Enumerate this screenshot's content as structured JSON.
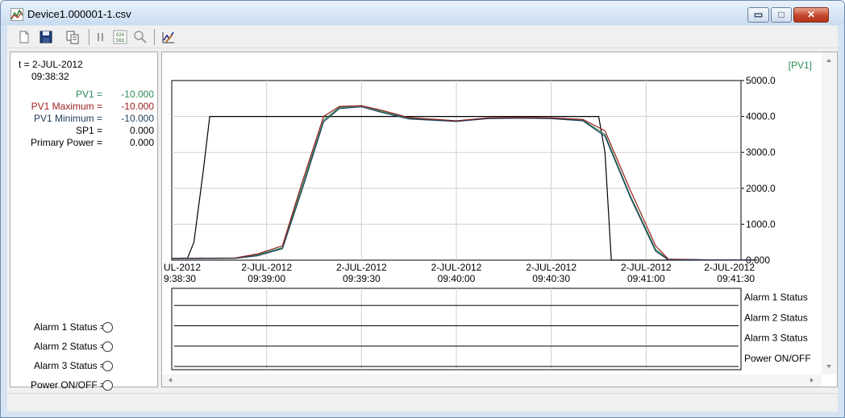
{
  "window": {
    "title": "Device1.000001-1.csv",
    "controls": {
      "minimize": "▭",
      "maximize": "□",
      "close": "✕"
    }
  },
  "toolbar": {
    "buttons": [
      {
        "name": "new-file-button",
        "icon": "new-file-icon"
      },
      {
        "name": "save-button",
        "icon": "save-icon"
      },
      {
        "name": "copy-button",
        "icon": "copy-icon"
      },
      {
        "name": "pause-button",
        "icon": "pause-icon"
      },
      {
        "name": "data-values-button",
        "icon": "data-values-icon",
        "text_top": "024",
        "text_bottom": "563"
      },
      {
        "name": "zoom-button",
        "icon": "zoom-icon"
      },
      {
        "name": "chart-settings-button",
        "icon": "chart-edit-icon"
      }
    ]
  },
  "readout": {
    "time_prefix": "t = 2-JUL-2012",
    "time_value": "09:38:32",
    "values": [
      {
        "label": "PV1 =",
        "value": "-10.000",
        "color": "#2e8b57"
      },
      {
        "label": "PV1 Maximum =",
        "value": "-10.000",
        "color": "#9b1b1b"
      },
      {
        "label": "PV1 Minimum =",
        "value": "-10.000",
        "color": "#1e3c5a"
      },
      {
        "label": "SP1 =",
        "value": "0.000",
        "color": "#000000"
      },
      {
        "label": "Primary Power =",
        "value": "0.000",
        "color": "#000000"
      }
    ]
  },
  "alarms": [
    {
      "label": "Alarm 1 Status ="
    },
    {
      "label": "Alarm 2 Status ="
    },
    {
      "label": "Alarm 3 Status ="
    },
    {
      "label": "Power ON/OFF ="
    }
  ],
  "chart_data": {
    "type": "line",
    "legend": "[PV1]",
    "ylim": [
      0,
      5000
    ],
    "yticks": [
      "5000.0",
      "4000.0",
      "3000.0",
      "2000.0",
      "1000.0",
      "0.000"
    ],
    "xticks": [
      {
        "date": "UL-2012",
        "time": "9:38:30"
      },
      {
        "date": "2-JUL-2012",
        "time": "09:39:00"
      },
      {
        "date": "2-JUL-2012",
        "time": "09:39:30"
      },
      {
        "date": "2-JUL-2012",
        "time": "09:40:00"
      },
      {
        "date": "2-JUL-2012",
        "time": "09:40:30"
      },
      {
        "date": "2-JUL-2012",
        "time": "09:41:00"
      },
      {
        "date": "2-JUL-2012",
        "time": "09:41:30"
      }
    ],
    "x_seconds": [
      0,
      30,
      60,
      90,
      120,
      150,
      180
    ],
    "series": [
      {
        "color": "#000000",
        "points": [
          [
            0,
            50
          ],
          [
            5,
            60
          ],
          [
            7,
            500
          ],
          [
            10,
            2500
          ],
          [
            12,
            4000
          ],
          [
            60,
            4000
          ],
          [
            120,
            4000
          ],
          [
            135,
            4000
          ],
          [
            137,
            3000
          ],
          [
            139,
            0
          ],
          [
            185,
            0
          ]
        ]
      },
      {
        "color": "#2e8b57",
        "points": [
          [
            0,
            50
          ],
          [
            20,
            60
          ],
          [
            27,
            150
          ],
          [
            35,
            350
          ],
          [
            41,
            2000
          ],
          [
            48,
            3900
          ],
          [
            53,
            4250
          ],
          [
            60,
            4300
          ],
          [
            66,
            4150
          ],
          [
            75,
            3950
          ],
          [
            90,
            3870
          ],
          [
            100,
            3950
          ],
          [
            110,
            3960
          ],
          [
            120,
            3950
          ],
          [
            130,
            3900
          ],
          [
            137,
            3500
          ],
          [
            145,
            1800
          ],
          [
            153,
            300
          ],
          [
            157,
            20
          ],
          [
            170,
            10
          ],
          [
            185,
            10
          ]
        ]
      },
      {
        "color": "#9b1b1b",
        "points": [
          [
            0,
            50
          ],
          [
            20,
            60
          ],
          [
            27,
            170
          ],
          [
            35,
            400
          ],
          [
            41,
            2100
          ],
          [
            48,
            4000
          ],
          [
            53,
            4280
          ],
          [
            60,
            4300
          ],
          [
            66,
            4180
          ],
          [
            75,
            3970
          ],
          [
            90,
            3880
          ],
          [
            100,
            3960
          ],
          [
            110,
            3970
          ],
          [
            120,
            3960
          ],
          [
            130,
            3920
          ],
          [
            137,
            3600
          ],
          [
            145,
            1950
          ],
          [
            153,
            400
          ],
          [
            157,
            30
          ],
          [
            170,
            10
          ],
          [
            185,
            10
          ]
        ]
      },
      {
        "color": "#1e3c5a",
        "points": [
          [
            0,
            40
          ],
          [
            20,
            50
          ],
          [
            27,
            120
          ],
          [
            35,
            320
          ],
          [
            41,
            1900
          ],
          [
            48,
            3850
          ],
          [
            53,
            4220
          ],
          [
            60,
            4270
          ],
          [
            66,
            4120
          ],
          [
            75,
            3930
          ],
          [
            90,
            3860
          ],
          [
            100,
            3940
          ],
          [
            110,
            3950
          ],
          [
            120,
            3940
          ],
          [
            130,
            3880
          ],
          [
            137,
            3450
          ],
          [
            145,
            1750
          ],
          [
            153,
            250
          ],
          [
            157,
            10
          ],
          [
            170,
            5
          ],
          [
            185,
            5
          ]
        ]
      }
    ],
    "status_rows": [
      "Alarm 1 Status",
      "Alarm 2 Status",
      "Alarm 3 Status",
      "Power ON/OFF"
    ]
  }
}
